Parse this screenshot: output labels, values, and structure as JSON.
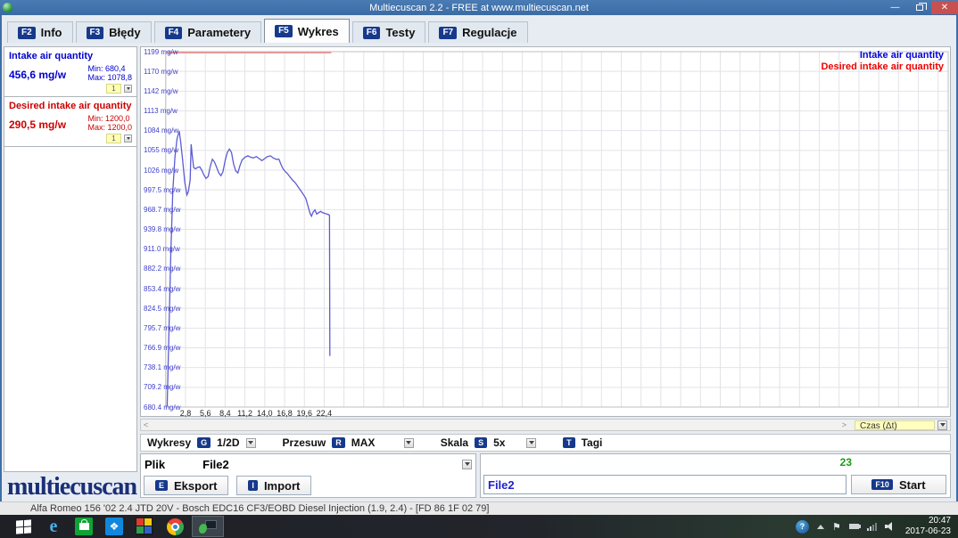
{
  "window": {
    "title": "Multiecuscan 2.2 - FREE at www.multiecuscan.net"
  },
  "tabs": [
    {
      "key": "F2",
      "label": "Info",
      "selected": false
    },
    {
      "key": "F3",
      "label": "Błędy",
      "selected": false
    },
    {
      "key": "F4",
      "label": "Parametery",
      "selected": false
    },
    {
      "key": "F5",
      "label": "Wykres",
      "selected": true
    },
    {
      "key": "F6",
      "label": "Testy",
      "selected": false
    },
    {
      "key": "F7",
      "label": "Regulacje",
      "selected": false
    }
  ],
  "params": [
    {
      "name": "Intake air quantity",
      "value": "456,6 mg/w",
      "min": "Min: 680,4",
      "max": "Max: 1078,8",
      "channel": "1",
      "color_class": "blue"
    },
    {
      "name": "Desired intake air quantity",
      "value": "290,5 mg/w",
      "min": "Min: 1200,0",
      "max": "Max: 1200,0",
      "channel": "1",
      "color_class": "red"
    }
  ],
  "logo_text": "multiecuscan",
  "chart_data": {
    "type": "line",
    "xlabel": "Czas (Δt)",
    "ylabel": "mg/w",
    "ylim": [
      680.4,
      1199
    ],
    "grid": true,
    "legend_position": "top-right",
    "y_ticks": [
      "1199 mg/w",
      "1170 mg/w",
      "1142 mg/w",
      "1113 mg/w",
      "1084 mg/w",
      "1055 mg/w",
      "1026 mg/w",
      "997.5 mg/w",
      "968.7 mg/w",
      "939.8 mg/w",
      "911.0 mg/w",
      "882.2 mg/w",
      "853.4 mg/w",
      "824.5 mg/w",
      "795.7 mg/w",
      "766.9 mg/w",
      "738.1 mg/w",
      "709.2 mg/w",
      "680.4 mg/w"
    ],
    "x_ticks": [
      "2,8",
      "5,6",
      "8,4",
      "11,2",
      "14,0",
      "16,8",
      "19,6",
      "22,4"
    ],
    "x_tick_step": 2.8,
    "series": [
      {
        "name": "Desired intake air quantity",
        "line_color": "#e79a9a",
        "legend_color": "#ee0000",
        "width": 2,
        "points": [
          [
            0.2,
            1200
          ],
          [
            23.4,
            1200
          ]
        ]
      },
      {
        "name": "Intake air quantity",
        "line_color": "#5b5bd6",
        "legend_color": "#0000dd",
        "width": 1.3,
        "points": [
          [
            0.2,
            682
          ],
          [
            0.45,
            790
          ],
          [
            0.7,
            900
          ],
          [
            1.0,
            995
          ],
          [
            1.3,
            1045
          ],
          [
            1.6,
            1072
          ],
          [
            1.9,
            1083
          ],
          [
            2.1,
            1068
          ],
          [
            2.4,
            1040
          ],
          [
            2.7,
            1008
          ],
          [
            3.0,
            990
          ],
          [
            3.2,
            995
          ],
          [
            3.45,
            1012
          ],
          [
            3.6,
            1064
          ],
          [
            3.75,
            1048
          ],
          [
            3.95,
            1030
          ],
          [
            4.2,
            1028
          ],
          [
            4.5,
            1030
          ],
          [
            4.8,
            1031
          ],
          [
            5.1,
            1026
          ],
          [
            5.4,
            1019
          ],
          [
            5.7,
            1014
          ],
          [
            6.0,
            1017
          ],
          [
            6.3,
            1032
          ],
          [
            6.6,
            1042
          ],
          [
            6.9,
            1038
          ],
          [
            7.2,
            1030
          ],
          [
            7.5,
            1022
          ],
          [
            7.8,
            1018
          ],
          [
            8.1,
            1024
          ],
          [
            8.4,
            1040
          ],
          [
            8.7,
            1052
          ],
          [
            9.0,
            1057
          ],
          [
            9.3,
            1052
          ],
          [
            9.6,
            1035
          ],
          [
            9.9,
            1025
          ],
          [
            10.2,
            1022
          ],
          [
            10.5,
            1033
          ],
          [
            10.8,
            1041
          ],
          [
            11.2,
            1045
          ],
          [
            11.6,
            1047
          ],
          [
            12.0,
            1045
          ],
          [
            12.4,
            1044
          ],
          [
            12.8,
            1046
          ],
          [
            13.2,
            1043
          ],
          [
            13.6,
            1040
          ],
          [
            14.0,
            1043
          ],
          [
            14.4,
            1046
          ],
          [
            14.8,
            1047
          ],
          [
            15.2,
            1044
          ],
          [
            15.6,
            1042
          ],
          [
            16.0,
            1042
          ],
          [
            16.3,
            1034
          ],
          [
            16.6,
            1028
          ],
          [
            16.9,
            1024
          ],
          [
            17.2,
            1021
          ],
          [
            17.5,
            1017
          ],
          [
            17.9,
            1012
          ],
          [
            18.3,
            1008
          ],
          [
            18.7,
            1002
          ],
          [
            19.1,
            996
          ],
          [
            19.5,
            990
          ],
          [
            19.8,
            985
          ],
          [
            20.1,
            974
          ],
          [
            20.4,
            963
          ],
          [
            20.6,
            959
          ],
          [
            20.85,
            965
          ],
          [
            21.1,
            968
          ],
          [
            21.35,
            962
          ],
          [
            21.6,
            964
          ],
          [
            21.9,
            966
          ],
          [
            22.2,
            964
          ],
          [
            22.5,
            963
          ],
          [
            22.8,
            962
          ],
          [
            23.05,
            961
          ],
          [
            23.15,
            960
          ],
          [
            23.2,
            755
          ]
        ]
      }
    ]
  },
  "chart_scroll": {
    "left_arrow": "<",
    "right_arrow": ">",
    "x_axis_select": "Czas (Δt)"
  },
  "controls": {
    "wykresy": {
      "label": "Wykresy",
      "key": "G",
      "value": "1/2D"
    },
    "przesuw": {
      "label": "Przesuw",
      "key": "R",
      "value": "MAX"
    },
    "skala": {
      "label": "Skala",
      "key": "S",
      "value": "5x"
    },
    "tagi": {
      "label": "Tagi",
      "key": "T"
    }
  },
  "file_section": {
    "plik_label": "Plik",
    "plik_value": "File2",
    "eksport_key": "E",
    "eksport_label": "Eksport",
    "import_key": "I",
    "import_label": "Import",
    "filename_value": "File2",
    "counter": "23",
    "start_key": "F10",
    "start_label": "Start"
  },
  "status_bar": "Alfa Romeo 156 '02 2.4 JTD 20V - Bosch EDC16 CF3/EOBD Diesel Injection (1.9, 2.4) - [FD 86 1F 02 79]",
  "taskbar": {
    "icons": [
      "start",
      "internet-explorer",
      "windows-store",
      "dropbox",
      "photos-app",
      "chrome",
      "multiecuscan-active"
    ],
    "tray_icons": [
      "help",
      "tray-expand-chevron",
      "action-center-flag",
      "battery",
      "network-signal",
      "volume"
    ],
    "clock_time": "20:47",
    "clock_date": "2017-06-23"
  },
  "colors": {
    "titlebar": "#3d6fa8",
    "badge": "#16398c",
    "param_blue": "#0000cd",
    "param_red": "#cc0000",
    "line_blue": "#5b5bd6",
    "line_red": "#e79a9a",
    "counter_green": "#1a9a1a",
    "select_yellow": "#ffffbe"
  }
}
